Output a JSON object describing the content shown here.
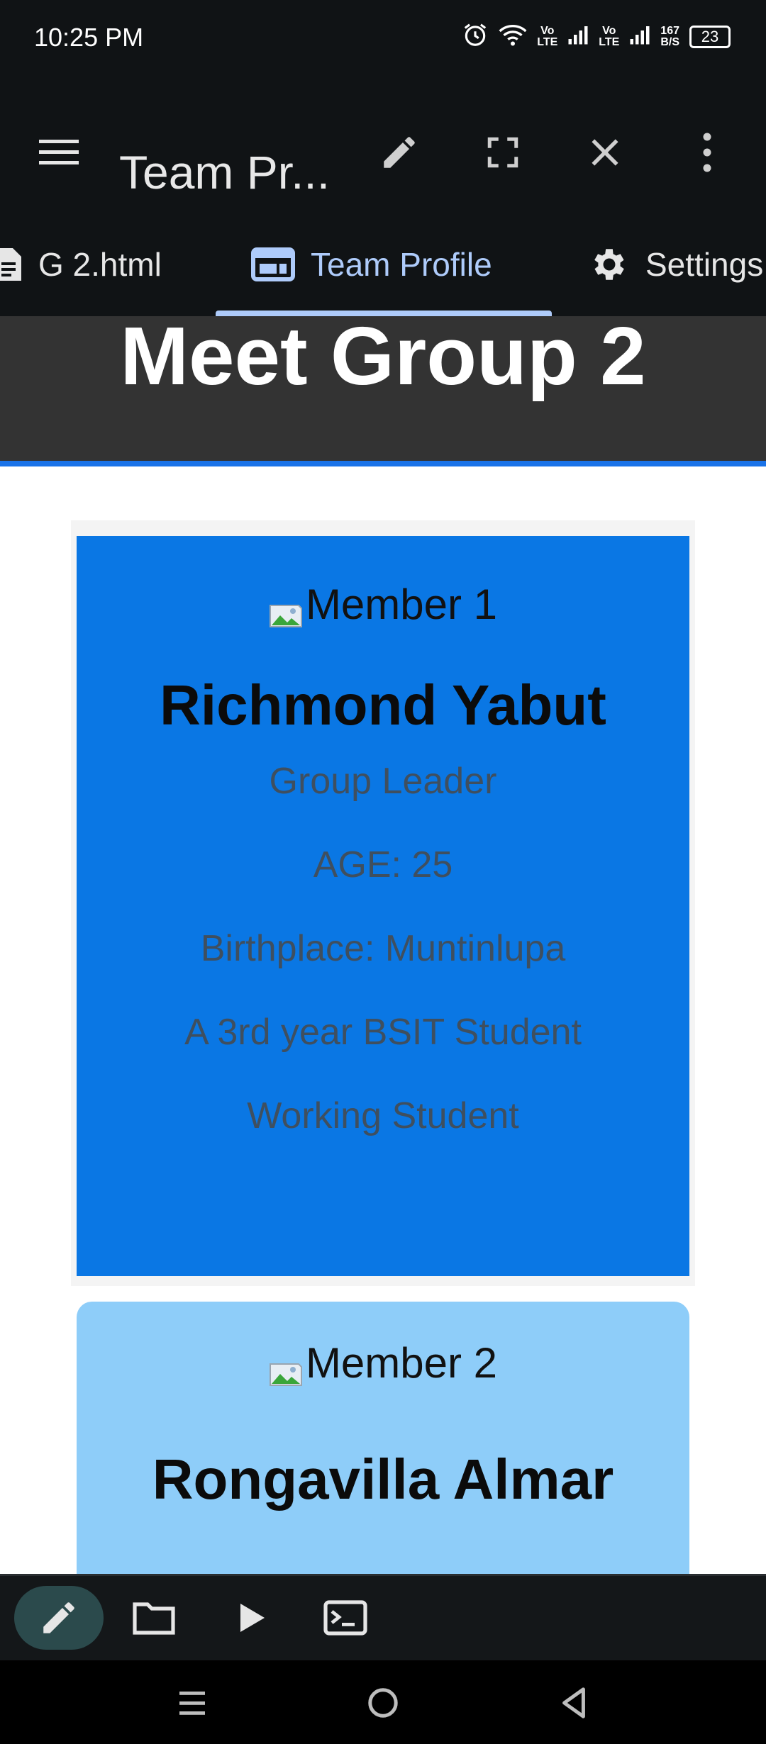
{
  "status_bar": {
    "time": "10:25 PM",
    "net1": "Vo\nLTE",
    "net2": "Vo\nLTE",
    "speed": "167\nB/S",
    "battery": "23"
  },
  "app_bar": {
    "title": "Team Pr..."
  },
  "tabs": [
    {
      "label": "G 2.html"
    },
    {
      "label": "Team Profile"
    },
    {
      "label": "Settings"
    }
  ],
  "page": {
    "heading": "Meet Group 2",
    "cards": [
      {
        "image_alt": "Member 1",
        "name": "Richmond Yabut",
        "lines": [
          "Group Leader",
          "AGE: 25",
          "Birthplace: Muntinlupa",
          "A 3rd year BSIT Student",
          "Working Student"
        ]
      },
      {
        "image_alt": "Member 2",
        "name": "Rongavilla Almar"
      }
    ]
  },
  "colors": {
    "accent": "#aecbfa",
    "card1_bg": "#0a77e4",
    "card2_bg": "#8ecdf9",
    "hero_bg": "#333333",
    "hero_border": "#1a73e8"
  },
  "icons": {
    "toolbar": [
      "pencil-icon",
      "folder-icon",
      "play-icon",
      "terminal-icon"
    ],
    "nav": [
      "recents-icon",
      "home-icon",
      "back-icon"
    ]
  }
}
